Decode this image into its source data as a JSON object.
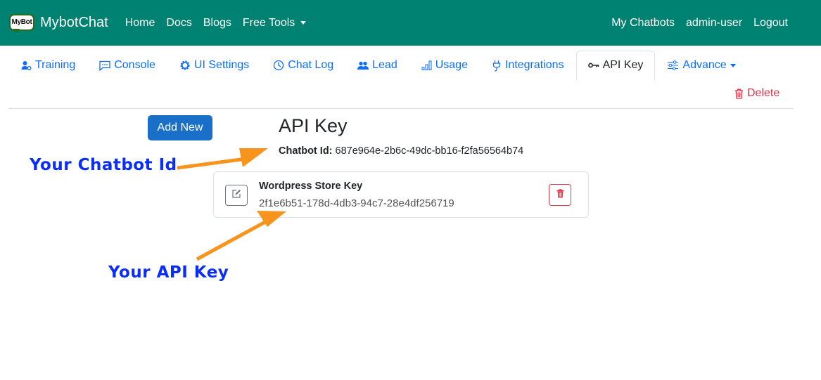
{
  "navbar": {
    "brand_logo_text": "MyBot",
    "brand_name": "MybotChat",
    "links": [
      {
        "label": "Home"
      },
      {
        "label": "Docs"
      },
      {
        "label": "Blogs"
      },
      {
        "label": "Free Tools",
        "dropdown": true
      }
    ],
    "right_links": [
      {
        "label": "My Chatbots"
      },
      {
        "label": "admin-user"
      },
      {
        "label": "Logout"
      }
    ],
    "background_color": "#008272"
  },
  "tabs": [
    {
      "label": "Training",
      "icon": "user-gear-icon"
    },
    {
      "label": "Console",
      "icon": "chat-dots-icon"
    },
    {
      "label": "UI Settings",
      "icon": "gear-icon"
    },
    {
      "label": "Chat Log",
      "icon": "clock-icon"
    },
    {
      "label": "Lead",
      "icon": "people-icon"
    },
    {
      "label": "Usage",
      "icon": "bar-chart-icon"
    },
    {
      "label": "Integrations",
      "icon": "plug-icon"
    },
    {
      "label": "API Key",
      "icon": "key-icon",
      "active": true
    },
    {
      "label": "Advance",
      "icon": "sliders-icon",
      "dropdown": true
    }
  ],
  "actions": {
    "delete_label": "Delete",
    "add_new_label": "Add New"
  },
  "main": {
    "title": "API Key",
    "chatbot_id_label": "Chatbot Id:",
    "chatbot_id_value": "687e964e-2b6c-49dc-bb16-f2fa56564b74",
    "keys": [
      {
        "name": "Wordpress Store Key",
        "value": "2f1e6b51-178d-4db3-94c7-28e4df256719"
      }
    ]
  },
  "annotations": {
    "chatbot_id_callout": "Your Chatbot Id",
    "api_key_callout": "Your API Key",
    "arrow_color": "#f7941d",
    "text_color": "#0a2ef5"
  },
  "colors": {
    "link": "#0d6efd",
    "danger": "#dc3545",
    "primary_button": "#1a6fc8"
  }
}
